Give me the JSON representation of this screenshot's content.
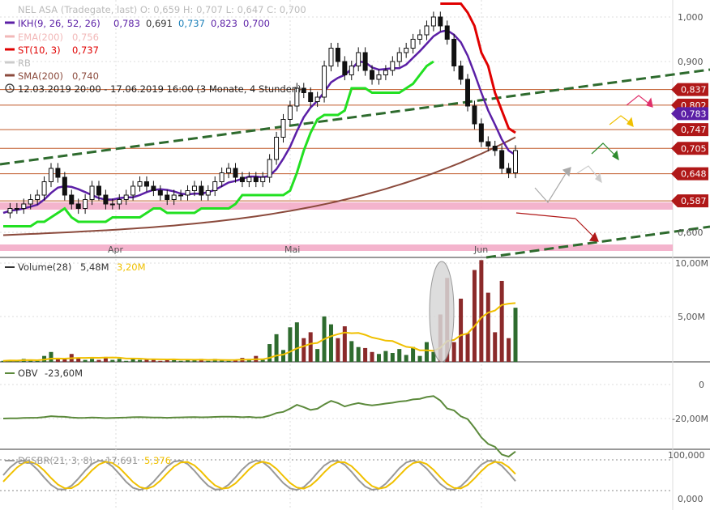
{
  "header": {
    "title": "NEL ASA (Tradegate, last)  O: 0,659  H: 0,707  L: 0,647  C: 0,700",
    "ikh_name": "IKH(9, 26, 52, 26)",
    "ikh_values": [
      "0,783",
      "0,691",
      "0,737",
      "0,823",
      "0,700"
    ],
    "ema_name": "EMA(200)",
    "ema_value": "0,756",
    "st_name": "ST(10, 3)",
    "st_value": "0,737",
    "rb_name": "RB",
    "sma_name": "SMA(200)",
    "sma_value": "0,740",
    "range": "12.03.2019 20:00 - 17.06.2019 16:00  (3 Monate, 4 Stunden)"
  },
  "colors": {
    "ikh": "#5b1fa6",
    "ema": "#f2b8b8",
    "st_red": "#e00000",
    "st_green": "#22e022",
    "sma": "#8b4a3c",
    "trend": "#2e6b2e",
    "zone": "#f2a7c4",
    "tag_bg": "#b01818",
    "tag_ikh": "#5b1fa6",
    "vol_up": "#2e6b2e",
    "vol_down": "#8b2a2a",
    "vol_avg": "#f0c000",
    "obv": "#5c8a3c",
    "dss1": "#999999",
    "dss2": "#f0c000"
  },
  "price_axis": {
    "labels": [
      "1,000",
      "0,900",
      "0,600"
    ],
    "tags": [
      "0,837",
      "0,802",
      "0,783",
      "0,747",
      "0,705",
      "0,648",
      "0,587"
    ]
  },
  "x_axis": {
    "labels": [
      "Apr",
      "Mai",
      "Jun"
    ]
  },
  "volume_panel": {
    "name": "Volume(28)",
    "value": "5,48M",
    "avg_value": "3,20M",
    "axis_labels": [
      "10,00M",
      "5,00M"
    ]
  },
  "obv_panel": {
    "name": "OBV",
    "value": "-23,60M",
    "axis_labels": [
      "0",
      "-20,00M"
    ]
  },
  "dss_panel": {
    "name": "DSSBR(21, 3, 8)",
    "value1": "17,691",
    "value2": "5,376",
    "axis_labels": [
      "100,000",
      "0,000"
    ]
  },
  "chart_data": {
    "type": "candlestick",
    "instrument": "NEL ASA",
    "period": "12.03.2019 - 17.06.2019",
    "x_months": [
      "Apr",
      "Mai",
      "Jun"
    ],
    "ohlc_last": {
      "open": 0.659,
      "high": 0.707,
      "low": 0.647,
      "close": 0.7
    },
    "indicators": {
      "IKH": [
        0.783,
        0.691,
        0.737,
        0.823,
        0.7
      ],
      "EMA200": 0.756,
      "ST": 0.737,
      "SMA200": 0.74
    },
    "price_levels": [
      0.837,
      0.802,
      0.783,
      0.747,
      0.705,
      0.648,
      0.587
    ],
    "y_ticks": [
      0.6,
      0.9,
      1.0
    ],
    "close_series": [
      0.56,
      0.57,
      0.57,
      0.58,
      0.59,
      0.6,
      0.63,
      0.66,
      0.64,
      0.6,
      0.58,
      0.57,
      0.59,
      0.62,
      0.6,
      0.58,
      0.58,
      0.59,
      0.6,
      0.62,
      0.63,
      0.62,
      0.61,
      0.6,
      0.59,
      0.6,
      0.6,
      0.61,
      0.62,
      0.6,
      0.61,
      0.63,
      0.65,
      0.66,
      0.64,
      0.63,
      0.64,
      0.63,
      0.64,
      0.68,
      0.73,
      0.77,
      0.8,
      0.84,
      0.83,
      0.81,
      0.82,
      0.89,
      0.93,
      0.9,
      0.87,
      0.89,
      0.92,
      0.88,
      0.86,
      0.87,
      0.88,
      0.9,
      0.92,
      0.93,
      0.95,
      0.96,
      0.98,
      1.0,
      0.98,
      0.95,
      0.89,
      0.86,
      0.8,
      0.76,
      0.72,
      0.71,
      0.7,
      0.66,
      0.65,
      0.7
    ],
    "volume_millions": [
      0.1,
      0.2,
      0.1,
      0.3,
      0.2,
      0.1,
      0.6,
      1.0,
      0.4,
      0.3,
      0.8,
      0.4,
      0.2,
      0.3,
      0.2,
      0.5,
      0.2,
      0.3,
      0.1,
      0.4,
      0.2,
      0.3,
      0.2,
      0.1,
      0.2,
      0.3,
      0.1,
      0.2,
      0.2,
      0.3,
      0.1,
      0.3,
      0.2,
      0.1,
      0.2,
      0.4,
      0.3,
      0.6,
      0.2,
      1.8,
      2.8,
      1.2,
      3.5,
      4.0,
      2.4,
      3.0,
      1.3,
      4.6,
      3.8,
      2.4,
      3.6,
      2.1,
      1.5,
      1.4,
      1.0,
      0.8,
      1.1,
      0.9,
      1.3,
      0.7,
      1.5,
      0.6,
      2.0,
      1.0,
      4.8,
      8.5,
      2.0,
      6.4,
      2.9,
      9.3,
      10.3,
      7.0,
      3.0,
      8.2,
      2.4,
      5.48
    ],
    "volume_avg_millions": 3.2,
    "obv_millions": -23.6,
    "dssbr": [
      17.691,
      5.376
    ]
  }
}
